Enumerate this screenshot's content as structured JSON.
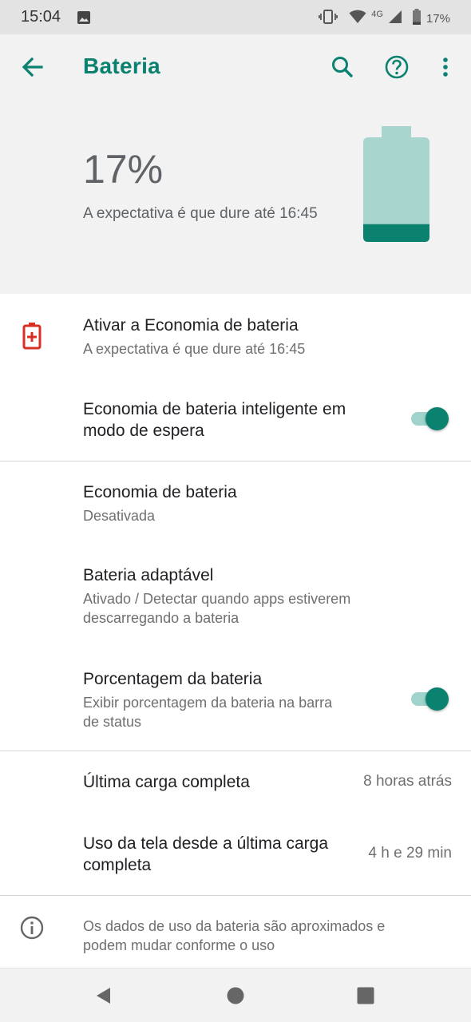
{
  "status_bar": {
    "time": "15:04",
    "network_label": "4G",
    "battery_text": "17%",
    "icons": [
      "image-icon",
      "vibrate-icon",
      "wifi-icon",
      "signal-icon",
      "battery-icon"
    ]
  },
  "app_bar": {
    "title": "Bateria",
    "icons": [
      "back-arrow-icon",
      "search-icon",
      "help-icon",
      "more-vert-icon"
    ]
  },
  "battery_summary": {
    "percent_text": "17%",
    "level": 0.17,
    "estimate": "A expectativa é que dure até 16:45"
  },
  "settings": {
    "battery_saver_activate": {
      "title": "Ativar a Economia de bateria",
      "subtitle": "A expectativa é que dure até 16:45",
      "icon": "battery-saver-icon"
    },
    "smart_standby": {
      "title_line1": "Economia de bateria inteligente em",
      "title_line2": "modo de espera",
      "enabled": true
    },
    "battery_saver": {
      "title": "Economia de bateria",
      "subtitle": "Desativada"
    },
    "adaptive_battery": {
      "title": "Bateria adaptável",
      "subtitle_line1": "Ativado / Detectar quando apps estiverem",
      "subtitle_line2": "descarregando a bateria"
    },
    "battery_percentage": {
      "title": "Porcentagem da bateria",
      "subtitle_line1": "Exibir porcentagem da bateria na barra",
      "subtitle_line2": "de status",
      "enabled": true
    },
    "last_full_charge": {
      "title": "Última carga completa",
      "value": "8 horas atrás"
    },
    "screen_usage": {
      "title_line1": "Uso da tela desde a última carga",
      "title_line2": "completa",
      "value": "4 h e 29 min"
    }
  },
  "footer": {
    "line1": "Os dados de uso da bateria são aproximados e",
    "line2": "podem mudar conforme o uso",
    "icon": "info-icon"
  },
  "nav_bar": {
    "icons": [
      "nav-back-icon",
      "nav-home-icon",
      "nav-recents-icon"
    ]
  },
  "colors": {
    "accent": "#0b8170",
    "accent_light": "#a8d5ce",
    "saver_red": "#d93025",
    "header_bg": "#f2f2f2",
    "status_bg": "#e3e3e3"
  }
}
